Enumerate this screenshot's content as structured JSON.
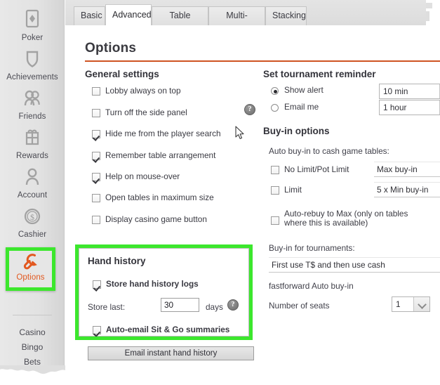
{
  "sidebar": {
    "items": [
      {
        "label": "Poker",
        "icon": "card-diamond-icon",
        "selected": false
      },
      {
        "label": "Achievements",
        "icon": "shield-icon",
        "selected": false
      },
      {
        "label": "Friends",
        "icon": "people-icon",
        "selected": false
      },
      {
        "label": "Rewards",
        "icon": "gift-icon",
        "selected": false
      },
      {
        "label": "Account",
        "icon": "person-icon",
        "selected": false
      },
      {
        "label": "Cashier",
        "icon": "dollar-coin-icon",
        "selected": false
      },
      {
        "label": "Options",
        "icon": "wrench-icon",
        "selected": true
      }
    ],
    "sub_links": [
      "Casino",
      "Bingo",
      "Bets"
    ]
  },
  "tabs": [
    {
      "label": "Basic",
      "active": false
    },
    {
      "label": "Advanced",
      "active": true
    },
    {
      "label": "Table options",
      "active": false
    },
    {
      "label": "Multi-tabling",
      "active": false
    },
    {
      "label": "Stacking",
      "active": false
    }
  ],
  "page": {
    "title": "Options"
  },
  "general_settings": {
    "heading": "General settings",
    "checkboxes": [
      {
        "label": "Lobby always on top",
        "checked": false
      },
      {
        "label": "Turn off the side panel",
        "checked": false
      },
      {
        "label": "Hide me from the player search",
        "checked": true
      },
      {
        "label": "Remember table arrangement",
        "checked": true
      },
      {
        "label": "Help on mouse-over",
        "checked": true
      },
      {
        "label": "Open tables in maximum size",
        "checked": false
      },
      {
        "label": "Display casino game button",
        "checked": false
      }
    ],
    "help_icon": "?"
  },
  "hand_history": {
    "heading": "Hand history",
    "store_logs": {
      "label": "Store hand history logs",
      "checked": true
    },
    "store_last_label": "Store last:",
    "store_last_value": "30",
    "days_label": "days",
    "help_icon": "?",
    "auto_email": {
      "label": "Auto-email Sit & Go summaries",
      "checked": true
    },
    "email_button": "Email instant hand history",
    "highlight_color": "#3ce72d"
  },
  "tournament_reminder": {
    "heading": "Set tournament reminder",
    "options": [
      {
        "label": "Show alert",
        "selected": true,
        "value": "10 min"
      },
      {
        "label": "Email me",
        "selected": false,
        "value": "1 hour"
      }
    ]
  },
  "buyin_options": {
    "heading": "Buy-in options",
    "cash_label": "Auto buy-in to cash game tables:",
    "rows": [
      {
        "label": "No Limit/Pot Limit",
        "checked": false,
        "value": "Max buy-in"
      },
      {
        "label": "Limit",
        "checked": false,
        "value": "5 x Min buy-in"
      }
    ],
    "auto_rebuy": {
      "label": "Auto-rebuy to Max (only on tables where this is available)",
      "checked": false
    },
    "tournaments_label": "Buy-in for tournaments:",
    "tournaments_value": "First use T$ and then use cash",
    "fastforward_label": "fastforward Auto buy-in",
    "seats_label": "Number of seats",
    "seats_value": "1"
  },
  "colors": {
    "accent": "#cf5422",
    "highlight": "#3ce72d",
    "sidebar_bg": "#e2e2e2"
  }
}
